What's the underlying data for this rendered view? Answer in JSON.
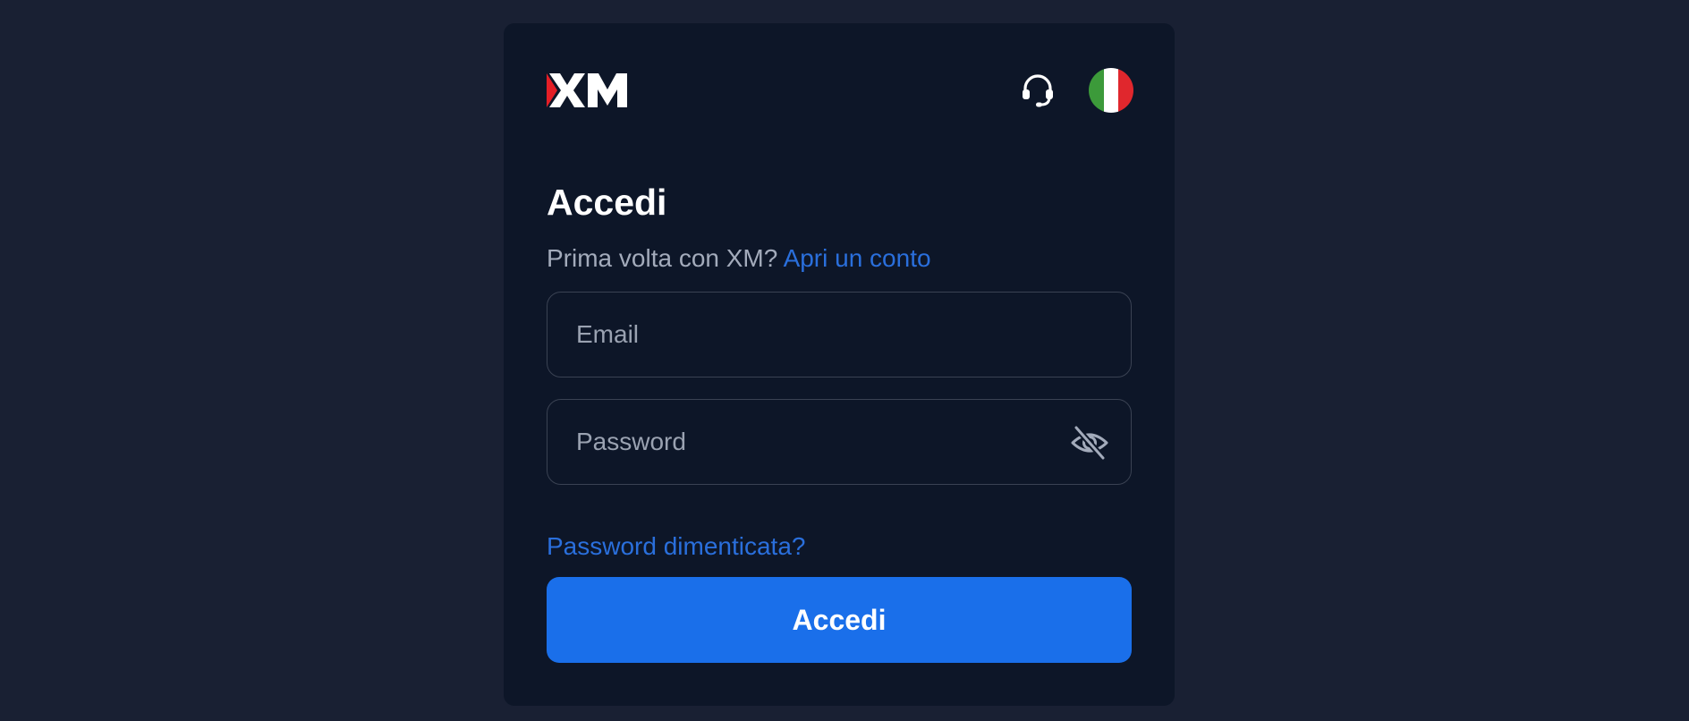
{
  "brand": {
    "logo_text": "XM",
    "logo_icon": "xm-logo",
    "accent_color": "#e41e26"
  },
  "header": {
    "support_icon": "headset-icon",
    "language_icon": "italy-flag-icon",
    "language_colors": [
      "#3c9a3a",
      "#ffffff",
      "#e0272d"
    ]
  },
  "login": {
    "title": "Accedi",
    "prompt": "Prima volta con XM?",
    "signup_link": "Apri un conto",
    "email_placeholder": "Email",
    "email_value": "",
    "password_placeholder": "Password",
    "password_value": "",
    "password_toggle_icon": "eye-off-icon",
    "forgot_link": "Password dimenticata?",
    "submit_label": "Accedi"
  },
  "colors": {
    "page_bg": "#192033",
    "card_bg": "#0d1628",
    "link": "#2a6fdc",
    "primary_button": "#1a6fea"
  }
}
